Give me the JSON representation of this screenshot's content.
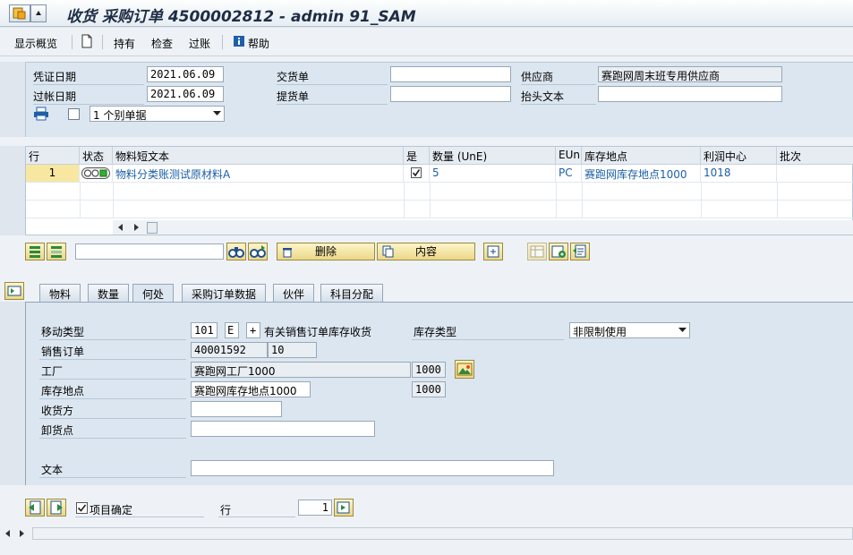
{
  "window": {
    "title": "收货 采购订单 4500002812 - admin 91_SAM"
  },
  "toolbar": {
    "overview": "显示概览",
    "hold": "持有",
    "check": "检查",
    "post": "过账",
    "help": "帮助"
  },
  "header": {
    "doc_date_label": "凭证日期",
    "doc_date_value": "2021.06.09",
    "post_date_label": "过帐日期",
    "post_date_value": "2021.06.09",
    "delivery_note_label": "交货单",
    "delivery_note_value": "",
    "bill_lading_label": "提货单",
    "bill_lading_value": "",
    "vendor_label": "供应商",
    "vendor_value": "赛跑网周末班专用供应商",
    "header_text_label": "抬头文本",
    "header_text_value": "",
    "print_option": "1 个别单据"
  },
  "table": {
    "columns": [
      "行",
      "状态",
      "物料短文本",
      "是",
      "数量 (UnE)",
      "EUn",
      "库存地点",
      "利润中心",
      "批次"
    ],
    "rows": [
      {
        "line": "1",
        "material_text": "物料分类账测试原材料A",
        "ok": true,
        "qty": "5",
        "unit": "PC",
        "sloc": "赛跑网库存地点1000",
        "profit_center": "1018",
        "batch": ""
      }
    ]
  },
  "actions": {
    "delete": "删除",
    "content": "内容",
    "search_value": ""
  },
  "tabs": [
    {
      "label": "物料",
      "active": false
    },
    {
      "label": "数量",
      "active": false
    },
    {
      "label": "何处",
      "active": true
    },
    {
      "label": "采购订单数据",
      "active": false
    },
    {
      "label": "伙伴",
      "active": false
    },
    {
      "label": "科目分配",
      "active": false
    }
  ],
  "where_tab": {
    "movement_type_label": "移动类型",
    "movement_type_value": "101",
    "movement_indicator": "E",
    "movement_plus": "+",
    "movement_desc": "有关销售订单库存收货",
    "stock_type_label": "库存类型",
    "stock_type_value": "非限制使用",
    "sales_order_label": "销售订单",
    "sales_order_value": "40001592",
    "sales_order_item": "10",
    "plant_label": "工厂",
    "plant_value": "赛跑网工厂1000",
    "plant_code": "1000",
    "sloc_label": "库存地点",
    "sloc_value": "赛跑网库存地点1000",
    "sloc_code": "1000",
    "recipient_label": "收货方",
    "recipient_value": "",
    "unload_label": "卸货点",
    "unload_value": "",
    "text_label": "文本",
    "text_value": ""
  },
  "footer": {
    "item_ok_label": "项目确定",
    "line_label": "行",
    "line_value": "1"
  },
  "colors": {
    "accent_yellow": "#ecd78a",
    "panel_blue": "#dce6f0",
    "link_blue": "#1b5fa8"
  }
}
